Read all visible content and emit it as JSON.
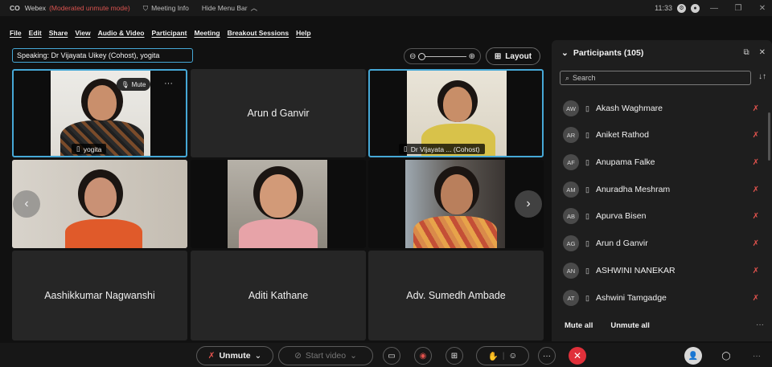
{
  "titlebar": {
    "logo": "CO",
    "app_name": "Webex",
    "mode": "(Moderated unmute mode)",
    "meeting_info": "Meeting Info",
    "hide_menu": "Hide Menu Bar",
    "clock": "11:33"
  },
  "menu": [
    "File",
    "Edit",
    "Share",
    "View",
    "Audio & Video",
    "Participant",
    "Meeting",
    "Breakout Sessions",
    "Help"
  ],
  "speaking": "Speaking: Dr Vijayata Uikey (Cohost), yogita",
  "layout_label": "Layout",
  "tiles": {
    "yogita_label": "yogita",
    "mute_label": "Mute",
    "arun": "Arun d Ganvir",
    "vijayata_label": "Dr Vijayata ... (Cohost)",
    "aashik": "Aashikkumar Nagwanshi",
    "aditi": "Aditi Kathane",
    "sumedh": "Adv. Sumedh Ambade"
  },
  "panel": {
    "title": "Participants (105)",
    "search_placeholder": "Search",
    "participants": [
      {
        "initials": "AW",
        "name": "Akash Waghmare"
      },
      {
        "initials": "AR",
        "name": "Aniket Rathod"
      },
      {
        "initials": "AF",
        "name": "Anupama Falke"
      },
      {
        "initials": "AM",
        "name": "Anuradha Meshram"
      },
      {
        "initials": "AB",
        "name": "Apurva Bisen"
      },
      {
        "initials": "AG",
        "name": "Arun d Ganvir"
      },
      {
        "initials": "AN",
        "name": "ASHWINI NANEKAR"
      },
      {
        "initials": "AT",
        "name": "Ashwini Tamgadge"
      }
    ],
    "mute_all": "Mute all",
    "unmute_all": "Unmute all"
  },
  "toolbar": {
    "unmute": "Unmute",
    "start_video": "Start video"
  },
  "colors": {
    "accent": "#46a8d6",
    "leave": "#e0303a",
    "muted": "#e0524d"
  }
}
